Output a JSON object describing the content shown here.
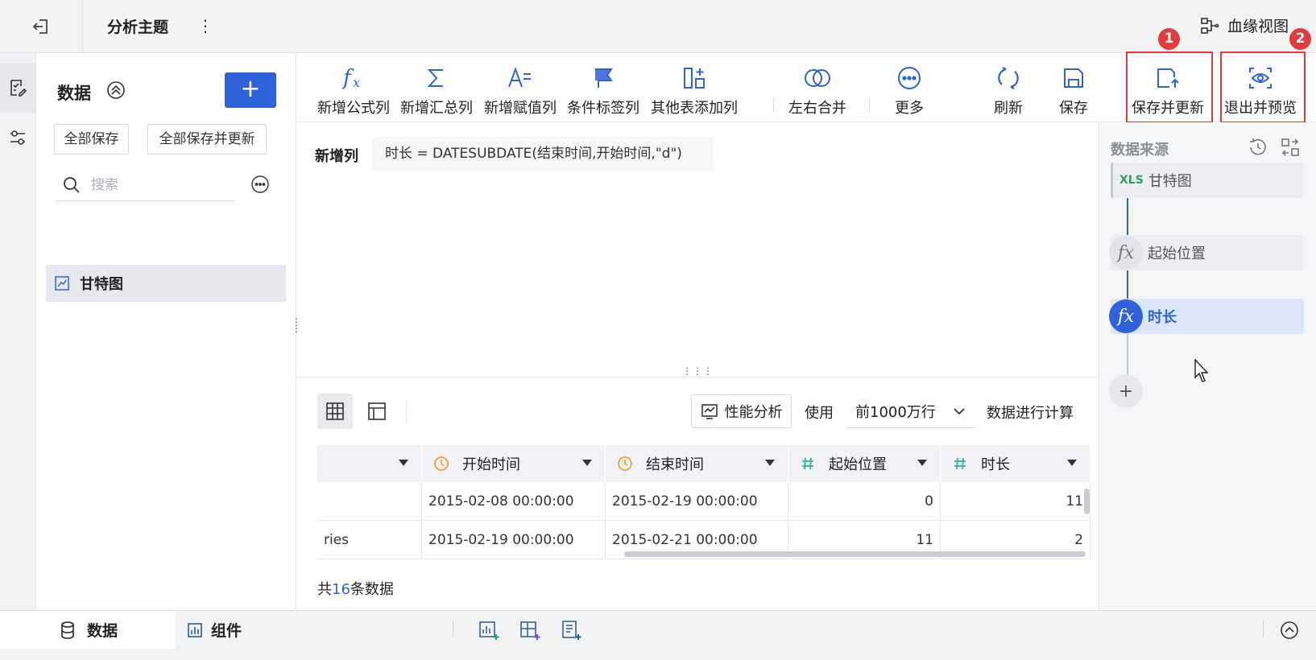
{
  "topbar": {
    "title": "分析主题",
    "more_icon": "⋮",
    "lineage_label": "血缘视图"
  },
  "rail": {
    "items": [
      "dataset-edit-icon",
      "filter-settings-icon"
    ]
  },
  "data_panel": {
    "title": "数据",
    "add_label": "+",
    "save_all_label": "全部保存",
    "save_all_update_label": "全部保存并更新",
    "search_placeholder": "搜索",
    "tree_items": [
      {
        "label": "甘特图"
      }
    ]
  },
  "toolbar": {
    "tools": [
      {
        "label": "新增公式列",
        "icon": "formula-icon"
      },
      {
        "label": "新增汇总列",
        "icon": "sigma-icon"
      },
      {
        "label": "新增赋值列",
        "icon": "assign-icon"
      },
      {
        "label": "条件标签列",
        "icon": "flag-icon"
      },
      {
        "label": "其他表添加列",
        "icon": "add-column-icon"
      },
      {
        "label": "左右合并",
        "icon": "merge-icon"
      },
      {
        "label": "更多",
        "icon": "more-icon"
      },
      {
        "label": "刷新",
        "icon": "refresh-icon"
      },
      {
        "label": "保存",
        "icon": "save-icon"
      },
      {
        "label": "保存并更新",
        "icon": "save-update-icon"
      },
      {
        "label": "退出并预览",
        "icon": "preview-icon"
      }
    ],
    "badges": [
      "1",
      "2"
    ],
    "highlight_color": "#e23b3b"
  },
  "formula": {
    "label": "新增列",
    "expression": "时长 = DATESUBDATE(结束时间,开始时间,\"d\")"
  },
  "preview": {
    "perf_label": "性能分析",
    "use_label": "使用",
    "rows_value": "前1000万行",
    "calc_label": "数据进行计算"
  },
  "table": {
    "columns": [
      {
        "name": "",
        "type": "text"
      },
      {
        "name": "开始时间",
        "type": "date"
      },
      {
        "name": "结束时间",
        "type": "date"
      },
      {
        "name": "起始位置",
        "type": "number"
      },
      {
        "name": "时长",
        "type": "number"
      }
    ],
    "rows": [
      [
        "",
        "2015-02-08 00:00:00",
        "2015-02-19 00:00:00",
        "0",
        "11"
      ],
      [
        "ries",
        "2015-02-19 00:00:00",
        "2015-02-21 00:00:00",
        "11",
        "2"
      ]
    ],
    "total_prefix": "共",
    "total_count": "16",
    "total_suffix": "条数据"
  },
  "right_panel": {
    "title": "数据来源",
    "steps": [
      {
        "label": "甘特图",
        "icon_text": "XLS",
        "state": "source"
      },
      {
        "label": "起始位置",
        "icon_text": "fx",
        "state": "normal"
      },
      {
        "label": "时长",
        "icon_text": "fx",
        "state": "active"
      }
    ],
    "add_label": "+"
  },
  "bottombar": {
    "tabs": [
      {
        "label": "数据",
        "active": true
      },
      {
        "label": "组件",
        "active": false
      }
    ]
  },
  "colors": {
    "accent": "#2f62d8",
    "highlight": "#e23b3b",
    "green": "#2e9e5b",
    "orange": "#f0a030",
    "teal": "#2cb39a"
  }
}
